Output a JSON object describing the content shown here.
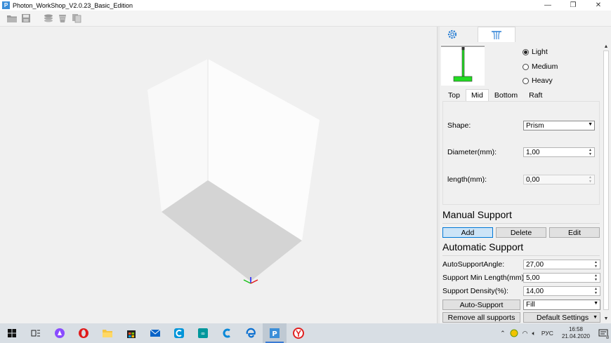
{
  "window": {
    "title": "Photon_WorkShop_V2.0.23_Basic_Edition",
    "app_icon_letter": "P",
    "controls": [
      "—",
      "❐",
      "✕"
    ]
  },
  "toolbar": {
    "icons": [
      "open-folder-icon",
      "save-icon",
      "layers-icon",
      "slice-icon",
      "copy-icon"
    ]
  },
  "panel": {
    "tabs": [
      {
        "icon": "gear-icon",
        "active": false
      },
      {
        "icon": "support-icon",
        "active": true
      }
    ],
    "density": {
      "options": [
        "Light",
        "Medium",
        "Heavy"
      ],
      "selected": "Light"
    },
    "subtabs": [
      "Top",
      "Mid",
      "Bottom",
      "Raft"
    ],
    "active_subtab": "Mid",
    "mid": {
      "shape_label": "Shape:",
      "shape_value": "Prism",
      "diameter_label": "Diameter(mm):",
      "diameter_value": "1,00",
      "length_label": "length(mm):",
      "length_value": "0,00"
    },
    "manual": {
      "title": "Manual Support",
      "add": "Add",
      "delete": "Delete",
      "edit": "Edit"
    },
    "automatic": {
      "title": "Automatic Support",
      "angle_label": "AutoSupportAngle:",
      "angle_value": "27,00",
      "minlen_label": "Support Min Length(mm):",
      "minlen_value": "5,00",
      "density_label": "Support Density(%):",
      "density_value": "14,00",
      "auto_button": "Auto-Support",
      "fill_value": "Fill",
      "remove_button": "Remove all supports",
      "default_button": "Default Settings"
    }
  },
  "taskbar": {
    "apps": [
      "windows-start-icon",
      "task-view-icon",
      "alice-icon",
      "opera-icon",
      "file-explorer-icon",
      "store-icon",
      "mail-icon",
      "ccleaner-icon",
      "arduino-icon",
      "cortana-c-icon",
      "edge-icon",
      "photon-icon",
      "yandex-icon"
    ],
    "language": "РУС",
    "time": "16:58",
    "date": "21.04.2020",
    "notification_count": "8"
  },
  "colors": {
    "accent": "#0078d7",
    "support_green": "#22dd22",
    "button_selected": "#cce4f7"
  }
}
